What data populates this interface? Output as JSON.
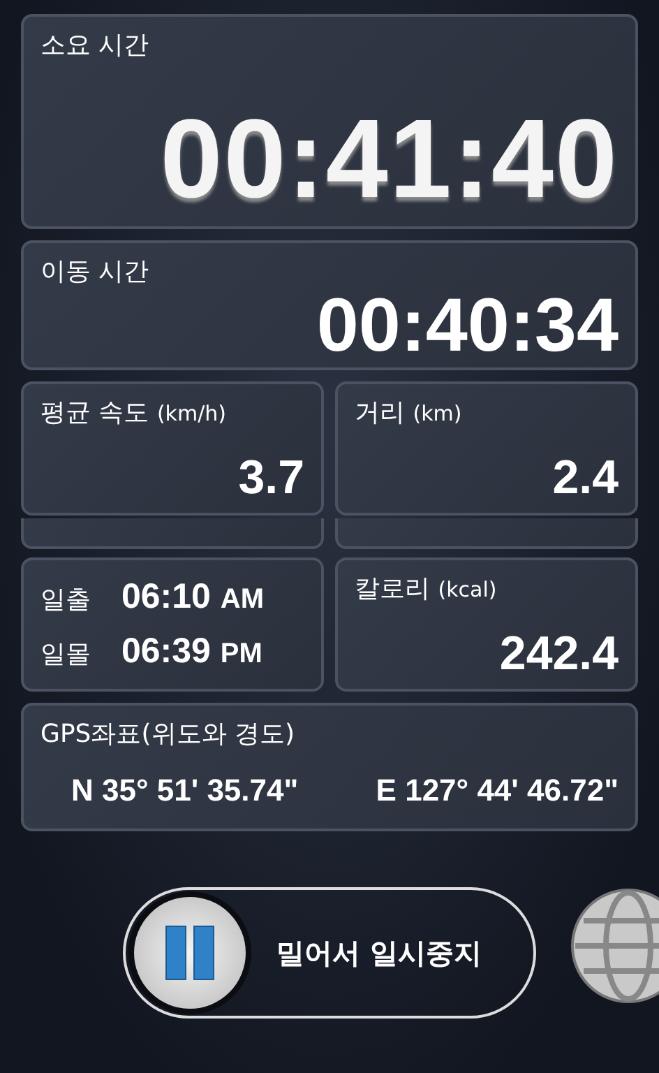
{
  "elapsed": {
    "label": "소요 시간",
    "value": "00:41:40"
  },
  "moving": {
    "label": "이동 시간",
    "value": "00:40:34"
  },
  "stats": [
    {
      "label": "평균 속도",
      "unit": "(km/h)",
      "value": "3.7"
    },
    {
      "label": "거리",
      "unit": "(km)",
      "value": "2.4"
    }
  ],
  "sun": [
    {
      "label": "일출",
      "time": "06:10",
      "ampm": "AM"
    },
    {
      "label": "일몰",
      "time": "06:39",
      "ampm": "PM"
    }
  ],
  "calories": {
    "label": "칼로리",
    "unit": "(kcal)",
    "value": "242.4"
  },
  "gps": {
    "label": "GPS좌표(위도와 경도)",
    "latitude": "N 35° 51' 35.74\"",
    "longitude": "E 127° 44' 46.72\""
  },
  "slider": {
    "label": "밀어서 일시중지",
    "level": 0
  }
}
